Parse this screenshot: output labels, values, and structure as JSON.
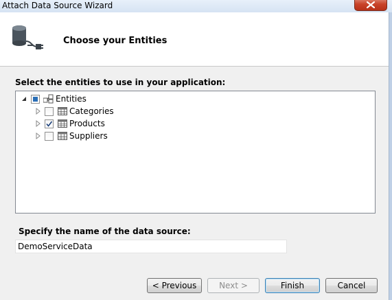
{
  "window": {
    "title": "Attach Data Source Wizard"
  },
  "header": {
    "title": "Choose your Entities"
  },
  "entities": {
    "label": "Select the entities to use in your application:",
    "root": {
      "label": "Entities",
      "state": "indeterminate"
    },
    "items": [
      {
        "label": "Categories",
        "checked": false
      },
      {
        "label": "Products",
        "checked": true
      },
      {
        "label": "Suppliers",
        "checked": false
      }
    ]
  },
  "data_source": {
    "label": "Specify the name of the data source:",
    "value": "DemoServiceData"
  },
  "buttons": {
    "previous": "< Previous",
    "next": "Next >",
    "finish": "Finish",
    "cancel": "Cancel"
  }
}
